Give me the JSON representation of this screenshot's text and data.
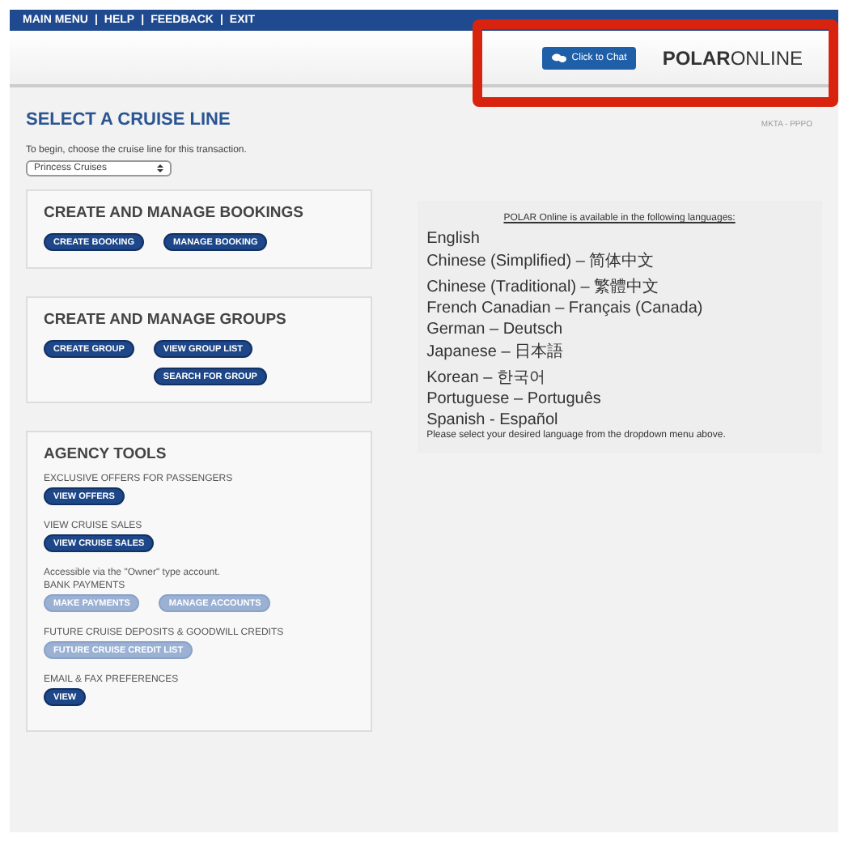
{
  "top_nav": {
    "links": [
      "MAIN MENU",
      "HELP",
      "FEEDBACK",
      "EXIT"
    ],
    "separator": "|"
  },
  "header": {
    "chat_button": "Click to Chat",
    "logo": {
      "bold": "POLAR",
      "light": "ONLINE"
    },
    "highlighted": true
  },
  "page_title": "SELECT A CRUISE LINE",
  "page_code": "MKTA - PPPO",
  "intro": "To begin, choose the cruise line for this transaction.",
  "cruise_line_select": {
    "value": "Princess Cruises"
  },
  "sections": [
    {
      "title": "CREATE AND MANAGE BOOKINGS",
      "groups": [
        {
          "buttons": [
            {
              "label": "CREATE BOOKING",
              "disabled": false
            },
            {
              "label": "MANAGE BOOKING",
              "disabled": false
            }
          ]
        }
      ]
    },
    {
      "title": "CREATE AND MANAGE GROUPS",
      "groups": [
        {
          "buttons": [
            {
              "label": "CREATE GROUP",
              "disabled": false
            },
            {
              "label": "VIEW GROUP LIST",
              "disabled": false
            },
            {
              "label": "SEARCH FOR GROUP",
              "disabled": false
            }
          ]
        }
      ]
    },
    {
      "title": "AGENCY TOOLS",
      "groups": [
        {
          "label": "EXCLUSIVE OFFERS FOR PASSENGERS",
          "buttons": [
            {
              "label": "VIEW OFFERS",
              "disabled": false
            }
          ]
        },
        {
          "label": "VIEW CRUISE SALES",
          "buttons": [
            {
              "label": "VIEW CRUISE SALES",
              "disabled": false
            }
          ]
        },
        {
          "note": "Accessible via the \"Owner\" type account.",
          "label": "BANK PAYMENTS",
          "buttons": [
            {
              "label": "MAKE PAYMENTS",
              "disabled": true
            },
            {
              "label": "MANAGE ACCOUNTS",
              "disabled": true
            }
          ]
        },
        {
          "label": "FUTURE CRUISE DEPOSITS & GOODWILL CREDITS",
          "buttons": [
            {
              "label": "FUTURE CRUISE CREDIT LIST",
              "disabled": true
            }
          ]
        },
        {
          "label": "EMAIL & FAX PREFERENCES",
          "buttons": [
            {
              "label": "VIEW",
              "disabled": false
            }
          ]
        }
      ]
    }
  ],
  "languages_panel": {
    "heading": "POLAR Online is available in the following languages:",
    "languages": [
      "English",
      "Chinese (Simplified) – 简体中文",
      "Chinese (Traditional) – 繁體中文",
      "French  Canadian – Français (Canada)",
      "German – Deutsch",
      "Japanese – 日本語",
      "Korean – 한국어",
      "Portuguese – Português",
      "Spanish - Español"
    ],
    "footer": "Please select your desired language from the dropdown menu above."
  }
}
